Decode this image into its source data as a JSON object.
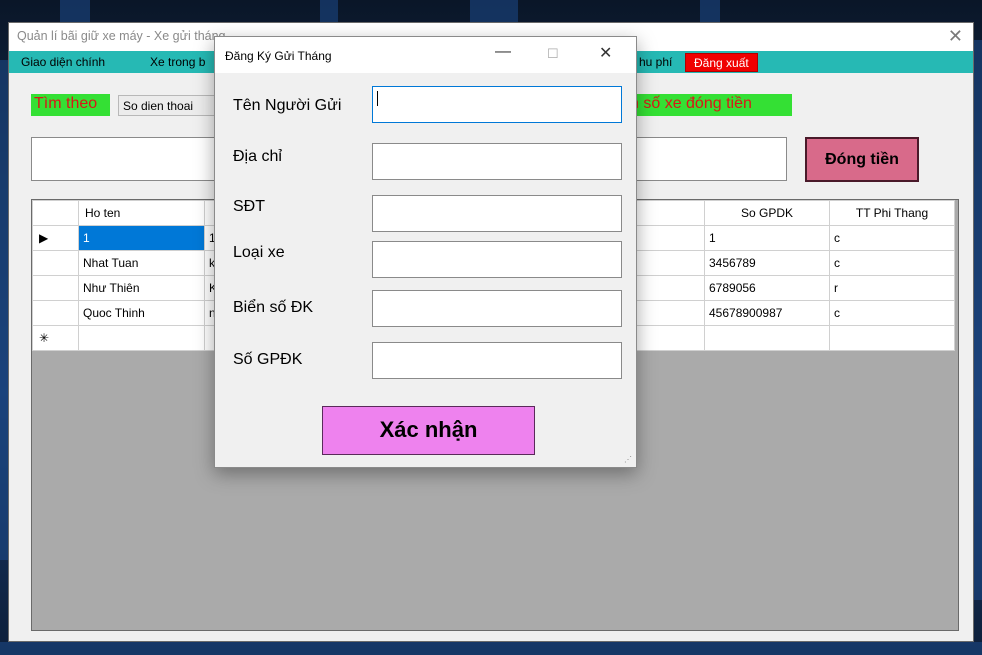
{
  "main_window": {
    "title": "Quản lí bãi giữ xe máy - Xe gửi tháng",
    "close_glyph": "✕"
  },
  "menu": {
    "items": [
      "Giao diện chính",
      "Xe trong b",
      "hu phí"
    ],
    "logout": "Đăng xuất"
  },
  "search": {
    "label": "Tìm theo",
    "select_value": "So dien thoai",
    "right_label": "n số xe đóng tiền"
  },
  "pay_button": "Đóng tiền",
  "grid": {
    "headers": [
      "Ho ten",
      "",
      "So GPDK",
      "TT Phi Thang"
    ],
    "rows": [
      {
        "marker": "▶",
        "name": "1",
        "col2": "1",
        "gpdk": "1",
        "tt": "c"
      },
      {
        "marker": "",
        "name": "Nhat Tuan",
        "col2": "k",
        "gpdk": "3456789",
        "tt": "c"
      },
      {
        "marker": "",
        "name": "Như Thiên",
        "col2": "K",
        "gpdk": "6789056",
        "tt": "r"
      },
      {
        "marker": "",
        "name": "Quoc Thinh",
        "col2": "n",
        "gpdk": "45678900987",
        "tt": "c"
      },
      {
        "marker": "✳",
        "name": "",
        "col2": "",
        "gpdk": "",
        "tt": ""
      }
    ]
  },
  "dialog": {
    "title": "Đăng Ký Gửi Tháng",
    "minimize_glyph": "—",
    "maximize_glyph": "☐",
    "close_glyph": "✕",
    "fields": [
      {
        "label": "Tên Người Gửi",
        "value": ""
      },
      {
        "label": "Địa chỉ",
        "value": ""
      },
      {
        "label": "SĐT",
        "value": ""
      },
      {
        "label": "Loại xe",
        "value": ""
      },
      {
        "label": "Biển số ĐK",
        "value": ""
      },
      {
        "label": "Số GPĐK",
        "value": ""
      }
    ],
    "confirm": "Xác nhận"
  }
}
